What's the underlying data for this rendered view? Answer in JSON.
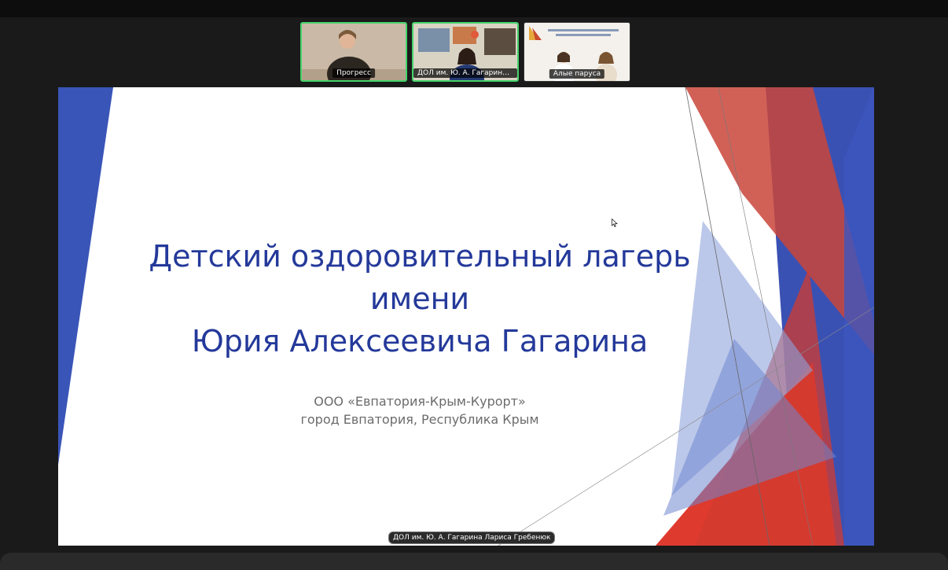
{
  "participants": [
    {
      "name": "Прогресс",
      "active": true
    },
    {
      "name": "ДОЛ им. Ю. А. Гагарина ...",
      "active": true
    },
    {
      "name": "Алые паруса",
      "active": false
    }
  ],
  "slide": {
    "title_lines": [
      "Детский оздоровительный лагерь",
      "имени",
      "Юрия Алексеевича Гагарина"
    ],
    "subtitle_lines": [
      "ООО «Евпатория-Крым-Курорт»",
      "город Евпатория, Республика Крым"
    ]
  },
  "speaker_label": "ДОЛ им. Ю. А. Гагарина Лариса Гребенюк",
  "colors": {
    "title": "#24399a",
    "blue": "#3a55b8",
    "red": "#d93a2e",
    "active_border": "#45d36a"
  }
}
